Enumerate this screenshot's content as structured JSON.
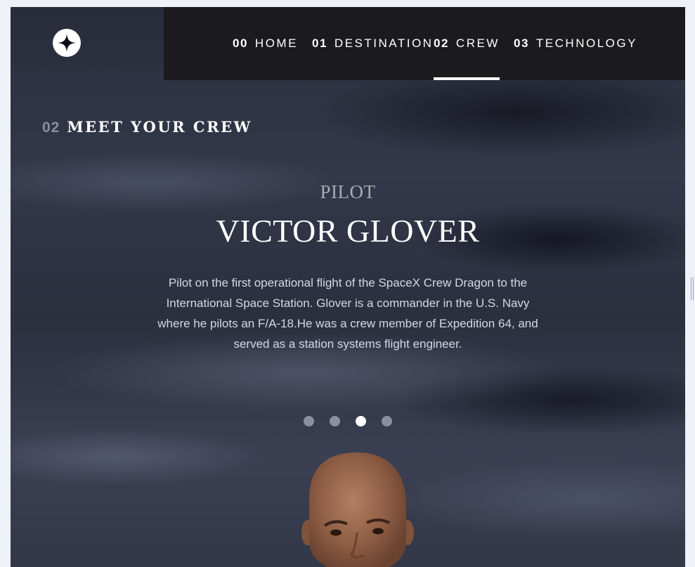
{
  "nav": {
    "items": [
      {
        "num": "00",
        "label": "HOME"
      },
      {
        "num": "01",
        "label": "DESTINATION"
      },
      {
        "num": "02",
        "label": "CREW"
      },
      {
        "num": "03",
        "label": "TECHNOLOGY"
      }
    ],
    "active": "CREW"
  },
  "logo_icon": "four-point-star-icon",
  "page": {
    "heading_num": "02",
    "heading": "MEET YOUR CREW"
  },
  "crew": {
    "role": "PILOT",
    "name": "VICTOR GLOVER",
    "bio": "Pilot on the first operational flight of the SpaceX Crew Dragon to the International Space Station. Glover is a commander in the U.S. Navy where he pilots an F/A-18.He was a crew member of Expedition 64, and served as a station systems flight engineer."
  },
  "carousel": {
    "count": 4,
    "active_index": 3
  },
  "colors": {
    "nav_bg": "#1b1b1d",
    "text_light": "#d4d7e6",
    "dot_inactive": "#8c909e",
    "dot_active": "#ffffff"
  }
}
